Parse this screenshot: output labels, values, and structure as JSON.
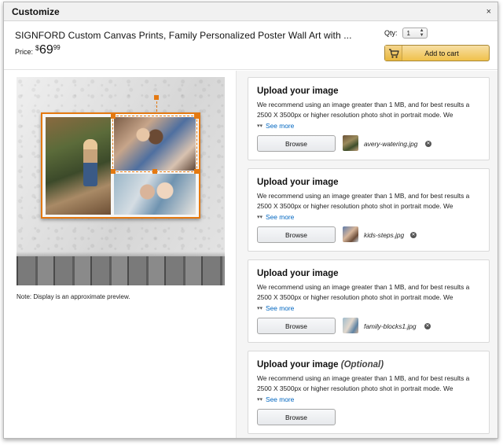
{
  "dialog": {
    "title": "Customize",
    "close_glyph": "×"
  },
  "product": {
    "title": "SIGNFORD Custom Canvas Prints, Family Personalized Poster Wall Art with ...",
    "price_label": "Price:",
    "price_currency": "$",
    "price_whole": "69",
    "price_fraction": "99",
    "qty_label": "Qty:",
    "qty_value": "1",
    "add_to_cart_label": "Add to cart"
  },
  "preview": {
    "note": "Note: Display is an approximate preview."
  },
  "uploads": [
    {
      "title": "Upload your image",
      "optional": "",
      "description": "We recommend using an image greater than 1 MB, and for best results a 2500 X 3500px or higher resolution photo shot in portrait mode. We",
      "see_more": "See more",
      "browse_label": "Browse",
      "file_name": "avery-watering.jpg"
    },
    {
      "title": "Upload your image",
      "optional": "",
      "description": "We recommend using an image greater than 1 MB, and for best results a 2500 X 3500px or higher resolution photo shot in portrait mode. We",
      "see_more": "See more",
      "browse_label": "Browse",
      "file_name": "kids-steps.jpg"
    },
    {
      "title": "Upload your image",
      "optional": "",
      "description": "We recommend using an image greater than 1 MB, and for best results a 2500 X 3500px or higher resolution photo shot in portrait mode. We",
      "see_more": "See more",
      "browse_label": "Browse",
      "file_name": "family-blocks1.jpg"
    },
    {
      "title": "Upload your image",
      "optional": "(Optional)",
      "description": "We recommend using an image greater than 1 MB, and for best results a 2500 X 3500px or higher resolution photo shot in portrait mode. We",
      "see_more": "See more",
      "browse_label": "Browse",
      "file_name": ""
    }
  ],
  "colors": {
    "accent_orange": "#e47911",
    "link_blue": "#0066c0",
    "cart_button": "#f0c14b"
  },
  "icons": {
    "close": "close-icon",
    "cart": "cart-icon",
    "chevron": "chevron-down-icon",
    "remove": "remove-file-icon"
  }
}
